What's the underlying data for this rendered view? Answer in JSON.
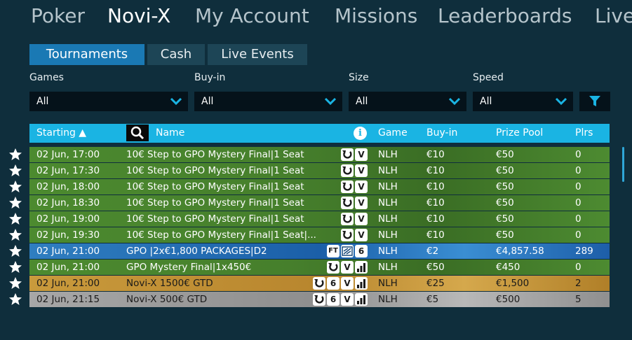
{
  "topnav": [
    "Poker",
    "Novi-X",
    "My Account",
    "Missions",
    "Leaderboards",
    "Live"
  ],
  "tabs": [
    "Tournaments",
    "Cash",
    "Live Events"
  ],
  "filters": {
    "games": {
      "label": "Games",
      "value": "All"
    },
    "buyin": {
      "label": "Buy-in",
      "value": "All"
    },
    "size": {
      "label": "Size",
      "value": "All"
    },
    "speed": {
      "label": "Speed",
      "value": "All"
    }
  },
  "table": {
    "headers": {
      "starting": "Starting ▲",
      "name": "Name",
      "game": "Game",
      "buyin": "Buy-in",
      "prize": "Prize Pool",
      "plrs": "Plrs"
    },
    "rows": [
      {
        "starting": "02 Jun, 17:00",
        "name": "10€ Step to GPO Mystery Final|1 Seat",
        "game": "NLH",
        "buyin": "€10",
        "prize": "€50",
        "plrs": "0",
        "style": "green",
        "badges": [
          "re-entry",
          "V"
        ]
      },
      {
        "starting": "02 Jun, 17:30",
        "name": "10€ Step to GPO Mystery Final|1 Seat",
        "game": "NLH",
        "buyin": "€10",
        "prize": "€50",
        "plrs": "0",
        "style": "green",
        "badges": [
          "re-entry",
          "V"
        ]
      },
      {
        "starting": "02 Jun, 18:00",
        "name": "10€ Step to GPO Mystery Final|1 Seat",
        "game": "NLH",
        "buyin": "€10",
        "prize": "€50",
        "plrs": "0",
        "style": "green",
        "badges": [
          "re-entry",
          "V"
        ]
      },
      {
        "starting": "02 Jun, 18:30",
        "name": "10€ Step to GPO Mystery Final|1 Seat",
        "game": "NLH",
        "buyin": "€10",
        "prize": "€50",
        "plrs": "0",
        "style": "green",
        "badges": [
          "re-entry",
          "V"
        ]
      },
      {
        "starting": "02 Jun, 19:00",
        "name": "10€ Step to GPO Mystery Final|1 Seat",
        "game": "NLH",
        "buyin": "€10",
        "prize": "€50",
        "plrs": "0",
        "style": "green",
        "badges": [
          "re-entry",
          "V"
        ]
      },
      {
        "starting": "02 Jun, 19:30",
        "name": "10€ Step to GPO Mystery Final|1 Seat|...",
        "game": "NLH",
        "buyin": "€10",
        "prize": "€50",
        "plrs": "0",
        "style": "green",
        "badges": [
          "re-entry",
          "V"
        ]
      },
      {
        "starting": "02 Jun, 21:00",
        "name": "GPO |2x€1,800 PACKAGES|D2",
        "game": "NLH",
        "buyin": "€2",
        "prize": "€4,857.58",
        "plrs": "289",
        "style": "blue",
        "badges": [
          "FT",
          "turbo",
          "6"
        ]
      },
      {
        "starting": "02 Jun, 21:00",
        "name": "GPO Mystery Final|1x450€",
        "game": "NLH",
        "buyin": "€50",
        "prize": "€450",
        "plrs": "0",
        "style": "green",
        "badges": [
          "re-entry",
          "V",
          "bars"
        ]
      },
      {
        "starting": "02 Jun, 21:00",
        "name": "Novi-X 1500€ GTD",
        "game": "NLH",
        "buyin": "€25",
        "prize": "€1,500",
        "plrs": "2",
        "style": "gold",
        "badges": [
          "re-entry",
          "6",
          "V",
          "bars"
        ]
      },
      {
        "starting": "02 Jun, 21:15",
        "name": "Novi-X 500€ GTD",
        "game": "NLH",
        "buyin": "€5",
        "prize": "€500",
        "plrs": "5",
        "style": "silver",
        "badges": [
          "re-entry",
          "6",
          "V",
          "bars"
        ]
      }
    ]
  },
  "colors": {
    "background": "#0f2e3c",
    "active_tab": "#1a79b4",
    "header": "#1ab4e3",
    "green_row": "#467f2c",
    "blue_row": "#1b5fa8",
    "gold_row": "#b8862e",
    "silver_row": "#8e8e8e"
  }
}
